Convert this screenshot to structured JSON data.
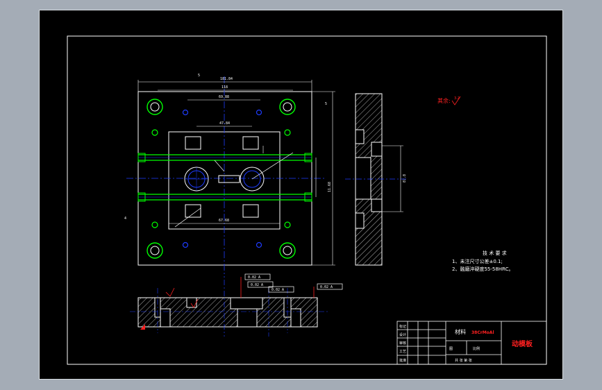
{
  "drawing": {
    "roughness_label": "其余:",
    "roughness_symbol": "3.2",
    "tech_requirements_title": "技 术 要 求",
    "tech_requirements": [
      "1、未注尺寸公差±0.1;",
      "2、融磨淬硬度55-58HRC。"
    ],
    "dimensions": {
      "overall_width": "181.84",
      "inner_top": "69.88",
      "inner_mid": "47.84",
      "slot_width": "118",
      "bottom_width": "67.68",
      "height_right": "11.68",
      "height_right_outer": "183",
      "side_height": "87.8",
      "left_dim": "5",
      "left_small": "4",
      "top_small": "5"
    },
    "gdt_frames": [
      "0.02 A",
      "0.02 A",
      "0.02 A",
      "0.02 A"
    ],
    "datum_label": "A"
  },
  "title_block": {
    "material_label": "材料",
    "material_value": "38CrMoAl",
    "part_name": "动模板",
    "row_labels": [
      "标记",
      "设计",
      "审核",
      "工艺",
      "批准"
    ],
    "scale_label": "图",
    "weight_label": "比例",
    "sheet_label": "共 张  第 张"
  },
  "colors": {
    "background": "#000000",
    "frame": "#ffffff",
    "center_line": "#1e3cff",
    "dimension": "#ffffff",
    "guide_pin": "#00ff00",
    "annotation_red": "#ff2020",
    "hatch": "#ffffff"
  }
}
